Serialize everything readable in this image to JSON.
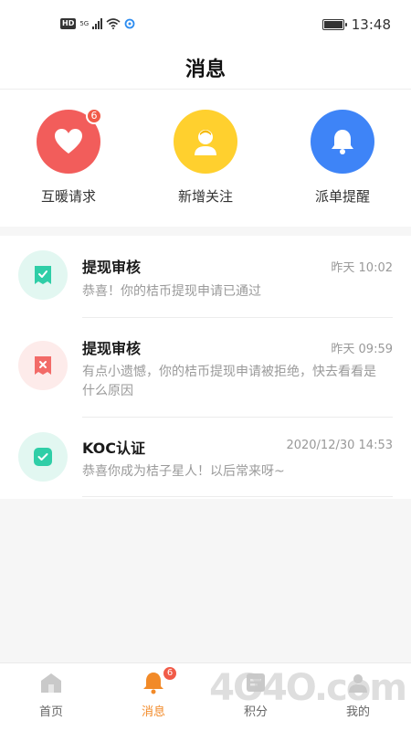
{
  "status_bar": {
    "hd": "HD",
    "network": "5G",
    "time": "13:48"
  },
  "header": {
    "title": "消息"
  },
  "quick_actions": [
    {
      "label": "互暖请求",
      "icon": "heart-icon",
      "color": "#f25d5b",
      "badge": "6"
    },
    {
      "label": "新增关注",
      "icon": "person-icon",
      "color": "#ffd02e",
      "badge": ""
    },
    {
      "label": "派单提醒",
      "icon": "bell-icon",
      "color": "#3e84f7",
      "badge": ""
    }
  ],
  "messages": [
    {
      "title": "提现审核",
      "time": "昨天 10:02",
      "desc": "恭喜！你的桔币提现申请已通过",
      "icon": "approved-receipt-icon",
      "icon_bg": "#e2f7f1",
      "icon_color": "#2fcea7"
    },
    {
      "title": "提现审核",
      "time": "昨天 09:59",
      "desc": "有点小遗憾，你的桔币提现申请被拒绝，快去看看是什么原因",
      "icon": "rejected-receipt-icon",
      "icon_bg": "#fdebea",
      "icon_color": "#f26b68"
    },
    {
      "title": "KOC认证",
      "time": "2020/12/30 14:53",
      "desc": "恭喜你成为桔子星人！以后常来呀~",
      "icon": "certified-badge-icon",
      "icon_bg": "#e2f7f1",
      "icon_color": "#2fcea7"
    }
  ],
  "tabbar": [
    {
      "label": "首页",
      "icon": "home-icon",
      "active": false,
      "badge": ""
    },
    {
      "label": "消息",
      "icon": "bell-icon",
      "active": true,
      "badge": "6"
    },
    {
      "label": "积分",
      "icon": "points-icon",
      "active": false,
      "badge": ""
    },
    {
      "label": "我的",
      "icon": "profile-icon",
      "active": false,
      "badge": ""
    }
  ],
  "watermark": "4O4O.com"
}
